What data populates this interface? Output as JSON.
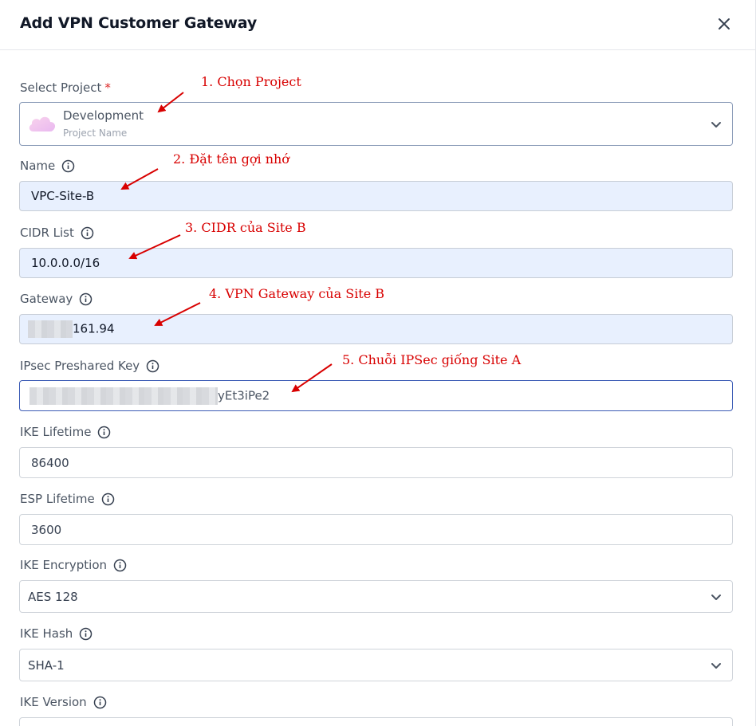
{
  "dialog": {
    "title": "Add VPN Customer Gateway"
  },
  "project": {
    "label": "Select Project",
    "required_mark": "*",
    "name": "Development",
    "subtitle": "Project Name"
  },
  "fields": {
    "name": {
      "label": "Name",
      "value": "VPC-Site-B"
    },
    "cidr": {
      "label": "CIDR List",
      "value": "10.0.0.0/16"
    },
    "gateway": {
      "label": "Gateway",
      "value_visible": "161.94"
    },
    "ipsec": {
      "label": "IPsec Preshared Key",
      "value_visible": "yEt3iPe2"
    },
    "ike_lifetime": {
      "label": "IKE Lifetime",
      "value": "86400"
    },
    "esp_lifetime": {
      "label": "ESP Lifetime",
      "value": "3600"
    },
    "ike_encryption": {
      "label": "IKE Encryption",
      "value": "AES 128"
    },
    "ike_hash": {
      "label": "IKE Hash",
      "value": "SHA-1"
    },
    "ike_version": {
      "label": "IKE Version"
    }
  },
  "annotations": {
    "a1": "1. Chọn Project",
    "a2": "2. Đặt tên gợi nhớ",
    "a3": "3. CIDR của Site B",
    "a4": "4. VPN Gateway của Site B",
    "a5": "5. Chuỗi IPSec giống Site A"
  },
  "colors": {
    "annotation": "#d80000",
    "filled_field": "#e8f0fe",
    "focus_border": "#3b5bb5",
    "required": "#dc2626"
  },
  "icons": [
    "close-icon",
    "info-icon",
    "chevron-down-icon",
    "cloud-icon"
  ]
}
